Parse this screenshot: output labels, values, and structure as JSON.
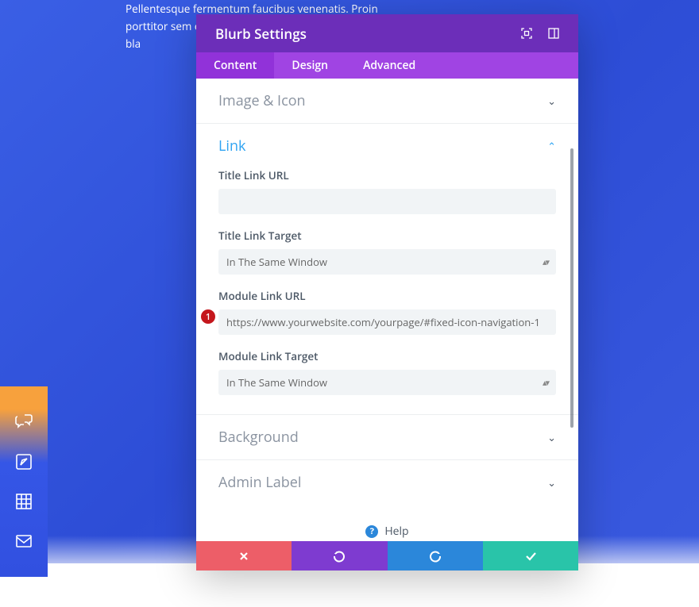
{
  "background_text": "Pellentesque fermentum faucibus venenatis. Proin porttitor sem eget varius neque suscipit mi fringilla. Cras bla",
  "sidebar": {
    "items": [
      {
        "name": "chat-icon"
      },
      {
        "name": "pen-icon"
      },
      {
        "name": "grid-icon"
      },
      {
        "name": "mail-icon"
      }
    ]
  },
  "modal": {
    "title": "Blurb Settings",
    "tabs": [
      {
        "label": "Content",
        "active": true
      },
      {
        "label": "Design",
        "active": false
      },
      {
        "label": "Advanced",
        "active": false
      }
    ],
    "sections": {
      "image_icon": {
        "title": "Image & Icon",
        "open": false
      },
      "link": {
        "title": "Link",
        "open": true,
        "fields": {
          "title_link_url": {
            "label": "Title Link URL",
            "value": ""
          },
          "title_link_target": {
            "label": "Title Link Target",
            "value": "In The Same Window"
          },
          "module_link_url": {
            "label": "Module Link URL",
            "value": "https://www.yourwebsite.com/yourpage/#fixed-icon-navigation-1",
            "annotation": "1"
          },
          "module_link_target": {
            "label": "Module Link Target",
            "value": "In The Same Window"
          }
        }
      },
      "background": {
        "title": "Background",
        "open": false
      },
      "admin_label": {
        "title": "Admin Label",
        "open": false
      }
    },
    "help_label": "Help",
    "footer": {
      "cancel": "✕",
      "undo": "↺",
      "redo": "↻",
      "save": "✓"
    }
  }
}
